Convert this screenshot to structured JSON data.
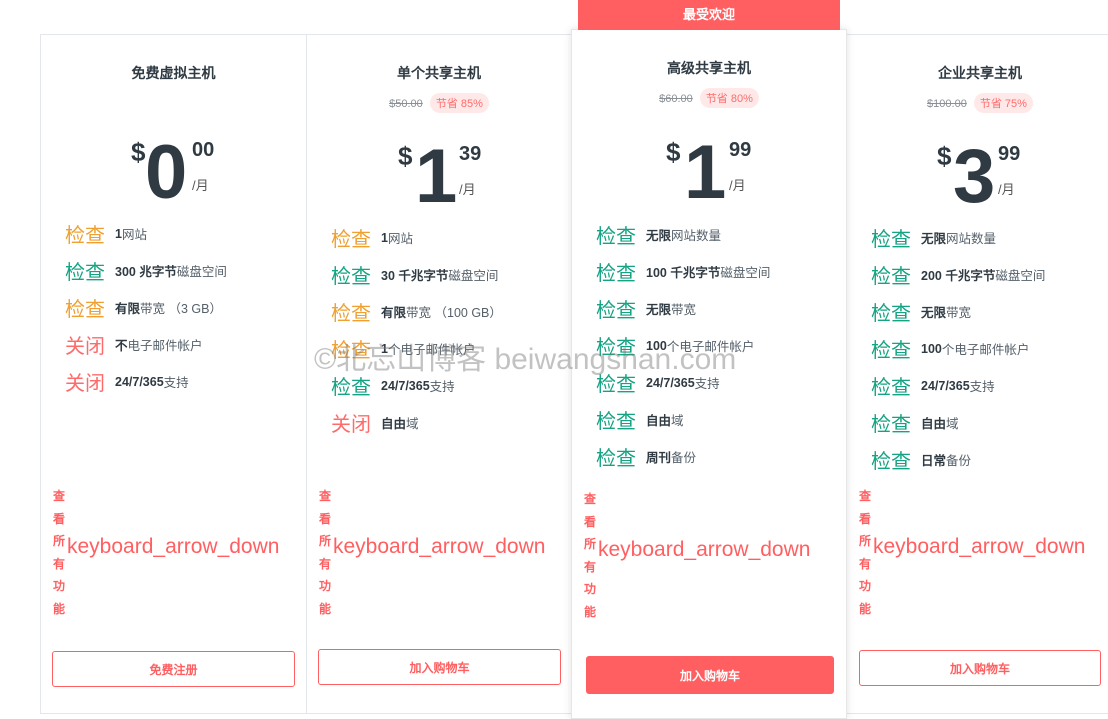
{
  "badge": "最受欢迎",
  "watermark": "©北忘山博客 beiwangshan.com",
  "plans": [
    {
      "title": "免费虚拟主机",
      "currency": "$",
      "whole": "0",
      "cents": "00",
      "per": "/月",
      "features": [
        {
          "status": "检查",
          "bold": "1",
          "text": "网站"
        },
        {
          "status": "检查",
          "bold": "300 兆字节",
          "text": "磁盘空间"
        },
        {
          "status": "检查",
          "bold": "有限",
          "text": "带宽 （3 GB）"
        },
        {
          "status": "关闭",
          "bold": "不",
          "text": "电子邮件帐户"
        },
        {
          "status": "关闭",
          "bold": "24/7/365",
          "text": "支持"
        }
      ],
      "more": "查看所有功能",
      "arrow": "keyboard_arrow_down",
      "cta": "免费注册"
    },
    {
      "title": "单个共享主机",
      "original_price": "$50.00",
      "save": "节省 85%",
      "currency": "$",
      "whole": "1",
      "cents": "39",
      "per": "/月",
      "features": [
        {
          "status": "检查",
          "bold": "1",
          "text": "网站"
        },
        {
          "status": "检查",
          "bold": "30 千兆字节",
          "text": "磁盘空间"
        },
        {
          "status": "检查",
          "bold": "有限",
          "text": "带宽 （100 GB）"
        },
        {
          "status": "检查",
          "bold": "1",
          "text": "个电子邮件帐户"
        },
        {
          "status": "检查",
          "bold": "24/7/365",
          "text": "支持"
        },
        {
          "status": "关闭",
          "bold": "自由",
          "text": "域"
        }
      ],
      "more": "查看所有功能",
      "arrow": "keyboard_arrow_down",
      "cta": "加入购物车"
    },
    {
      "title": "高级共享主机",
      "original_price": "$60.00",
      "save": "节省 80%",
      "currency": "$",
      "whole": "1",
      "cents": "99",
      "per": "/月",
      "features": [
        {
          "status": "检查",
          "bold": "无限",
          "text": "网站数量"
        },
        {
          "status": "检查",
          "bold": "100 千兆字节",
          "text": "磁盘空间"
        },
        {
          "status": "检查",
          "bold": "无限",
          "text": "带宽"
        },
        {
          "status": "检查",
          "bold": "100",
          "text": "个电子邮件帐户"
        },
        {
          "status": "检查",
          "bold": "24/7/365",
          "text": "支持"
        },
        {
          "status": "检查",
          "bold": "自由",
          "text": "域"
        },
        {
          "status": "检查",
          "bold": "周刊",
          "text": "备份"
        }
      ],
      "more": "查看所有功能",
      "arrow": "keyboard_arrow_down",
      "cta": "加入购物车"
    },
    {
      "title": "企业共享主机",
      "original_price": "$100.00",
      "save": "节省 75%",
      "currency": "$",
      "whole": "3",
      "cents": "99",
      "per": "/月",
      "features": [
        {
          "status": "检查",
          "bold": "无限",
          "text": "网站数量"
        },
        {
          "status": "检查",
          "bold": "200 千兆字节",
          "text": "磁盘空间"
        },
        {
          "status": "检查",
          "bold": "无限",
          "text": "带宽"
        },
        {
          "status": "检查",
          "bold": "100",
          "text": "个电子邮件帐户"
        },
        {
          "status": "检查",
          "bold": "24/7/365",
          "text": "支持"
        },
        {
          "status": "检查",
          "bold": "自由",
          "text": "域"
        },
        {
          "status": "检查",
          "bold": "日常",
          "text": "备份"
        }
      ],
      "more": "查看所有功能",
      "arrow": "keyboard_arrow_down",
      "cta": "加入购物车"
    }
  ],
  "colors": {
    "accent": "#ff5f61",
    "check_green": "#14a383",
    "check_orange": "#f0a030",
    "off_red": "#ff6b6b"
  }
}
